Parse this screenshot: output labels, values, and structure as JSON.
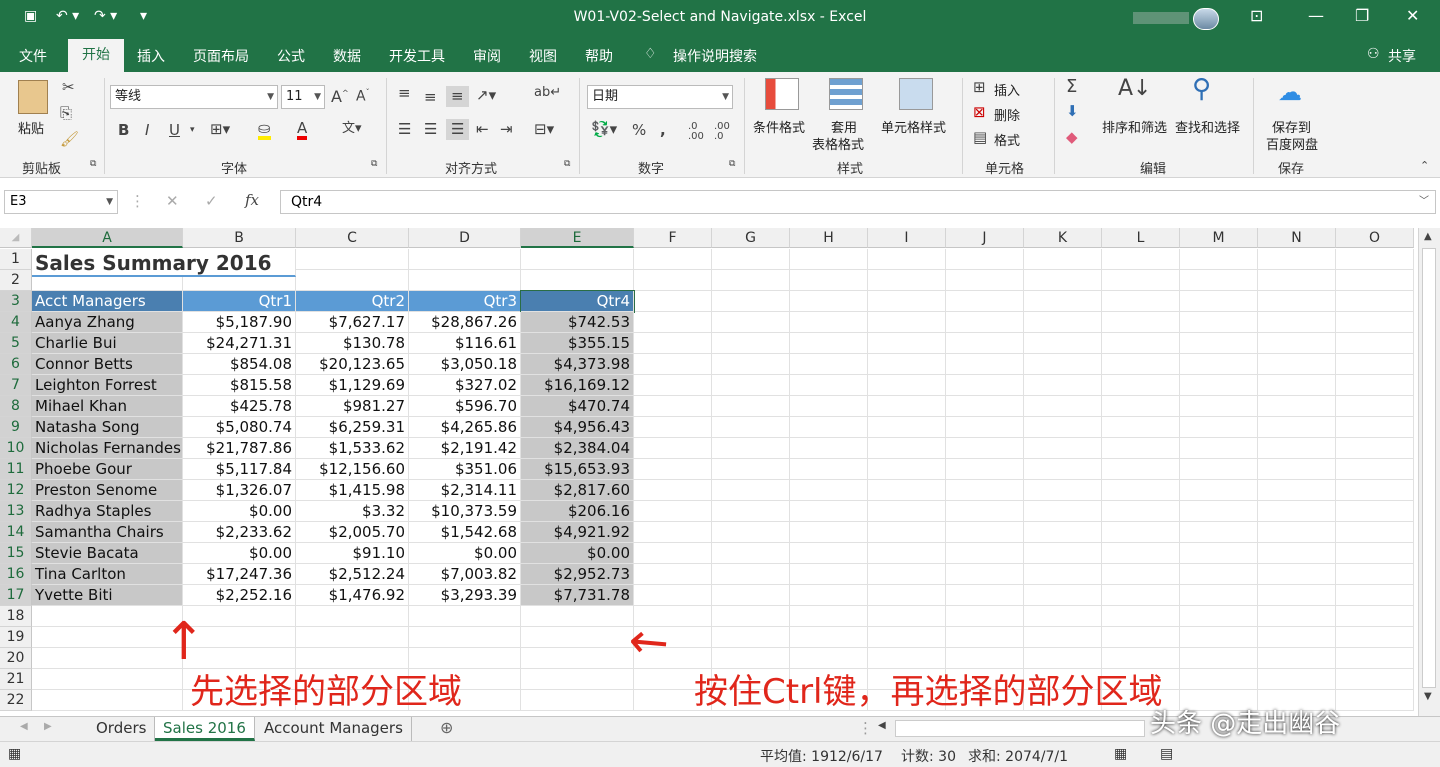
{
  "window": {
    "title": "W01-V02-Select and Navigate.xlsx  -  Excel"
  },
  "menu_tabs": [
    "文件",
    "开始",
    "插入",
    "页面布局",
    "公式",
    "数据",
    "开发工具",
    "审阅",
    "视图",
    "帮助"
  ],
  "tell_me": "操作说明搜索",
  "share": "共享",
  "ribbon": {
    "clipboard": {
      "paste": "粘贴",
      "label": "剪贴板"
    },
    "font": {
      "name": "等线",
      "size": "11",
      "label": "字体",
      "bold": "B",
      "italic": "I",
      "underline": "U"
    },
    "alignment": {
      "label": "对齐方式"
    },
    "number": {
      "format": "日期",
      "label": "数字",
      "percent": "%",
      "comma": "⁹"
    },
    "styles": {
      "conditional": "条件格式",
      "table_line1": "套用",
      "table_line2": "表格格式",
      "cell_styles": "单元格样式",
      "label": "样式"
    },
    "cells": {
      "insert": "插入",
      "delete": "删除",
      "format": "格式",
      "label": "单元格"
    },
    "editing": {
      "sort": "排序和筛选",
      "find": "查找和选择",
      "label": "编辑"
    },
    "save": {
      "line1": "保存到",
      "line2": "百度网盘",
      "label": "保存"
    }
  },
  "formula_bar": {
    "name_box": "E3",
    "fx": "fx",
    "content": "Qtr4"
  },
  "columns": [
    "A",
    "B",
    "C",
    "D",
    "E",
    "F",
    "G",
    "H",
    "I",
    "J",
    "K",
    "L",
    "M",
    "N",
    "O"
  ],
  "rows": [
    "1",
    "2",
    "3",
    "4",
    "5",
    "6",
    "7",
    "8",
    "9",
    "10",
    "11",
    "12",
    "13",
    "14",
    "15",
    "16",
    "17",
    "18",
    "19",
    "20",
    "21",
    "22"
  ],
  "sheet": {
    "title": "Sales Summary 2016",
    "header": [
      "Acct Managers",
      "Qtr1",
      "Qtr2",
      "Qtr3",
      "Qtr4"
    ],
    "data": [
      [
        "Aanya Zhang",
        "$5,187.90",
        "$7,627.17",
        "$28,867.26",
        "$742.53"
      ],
      [
        "Charlie Bui",
        "$24,271.31",
        "$130.78",
        "$116.61",
        "$355.15"
      ],
      [
        "Connor Betts",
        "$854.08",
        "$20,123.65",
        "$3,050.18",
        "$4,373.98"
      ],
      [
        "Leighton Forrest",
        "$815.58",
        "$1,129.69",
        "$327.02",
        "$16,169.12"
      ],
      [
        "Mihael Khan",
        "$425.78",
        "$981.27",
        "$596.70",
        "$470.74"
      ],
      [
        "Natasha Song",
        "$5,080.74",
        "$6,259.31",
        "$4,265.86",
        "$4,956.43"
      ],
      [
        "Nicholas Fernandes",
        "$21,787.86",
        "$1,533.62",
        "$2,191.42",
        "$2,384.04"
      ],
      [
        "Phoebe Gour",
        "$5,117.84",
        "$12,156.60",
        "$351.06",
        "$15,653.93"
      ],
      [
        "Preston Senome",
        "$1,326.07",
        "$1,415.98",
        "$2,314.11",
        "$2,817.60"
      ],
      [
        "Radhya Staples",
        "$0.00",
        "$3.32",
        "$10,373.59",
        "$206.16"
      ],
      [
        "Samantha Chairs",
        "$2,233.62",
        "$2,005.70",
        "$1,542.68",
        "$4,921.92"
      ],
      [
        "Stevie Bacata",
        "$0.00",
        "$91.10",
        "$0.00",
        "$0.00"
      ],
      [
        "Tina Carlton",
        "$17,247.36",
        "$2,512.24",
        "$7,003.82",
        "$2,952.73"
      ],
      [
        "Yvette Biti",
        "$2,252.16",
        "$1,476.92",
        "$3,293.39",
        "$7,731.78"
      ]
    ]
  },
  "annotations": {
    "left": "先选择的部分区域",
    "right": "按住Ctrl键，再选择的部分区域"
  },
  "sheet_tabs": [
    "Orders",
    "Sales 2016",
    "Account Managers"
  ],
  "active_sheet": "Sales 2016",
  "status": {
    "average": "平均值: 1912/6/17",
    "count": "计数: 30",
    "sum": "求和: 2074/7/1"
  },
  "watermark": "头条 @走出幽谷",
  "colors": {
    "excel_green": "#217346",
    "header_blue": "#5b9bd5",
    "selection_gray": "#c8c8c8",
    "annotation_red": "#e0261b"
  }
}
